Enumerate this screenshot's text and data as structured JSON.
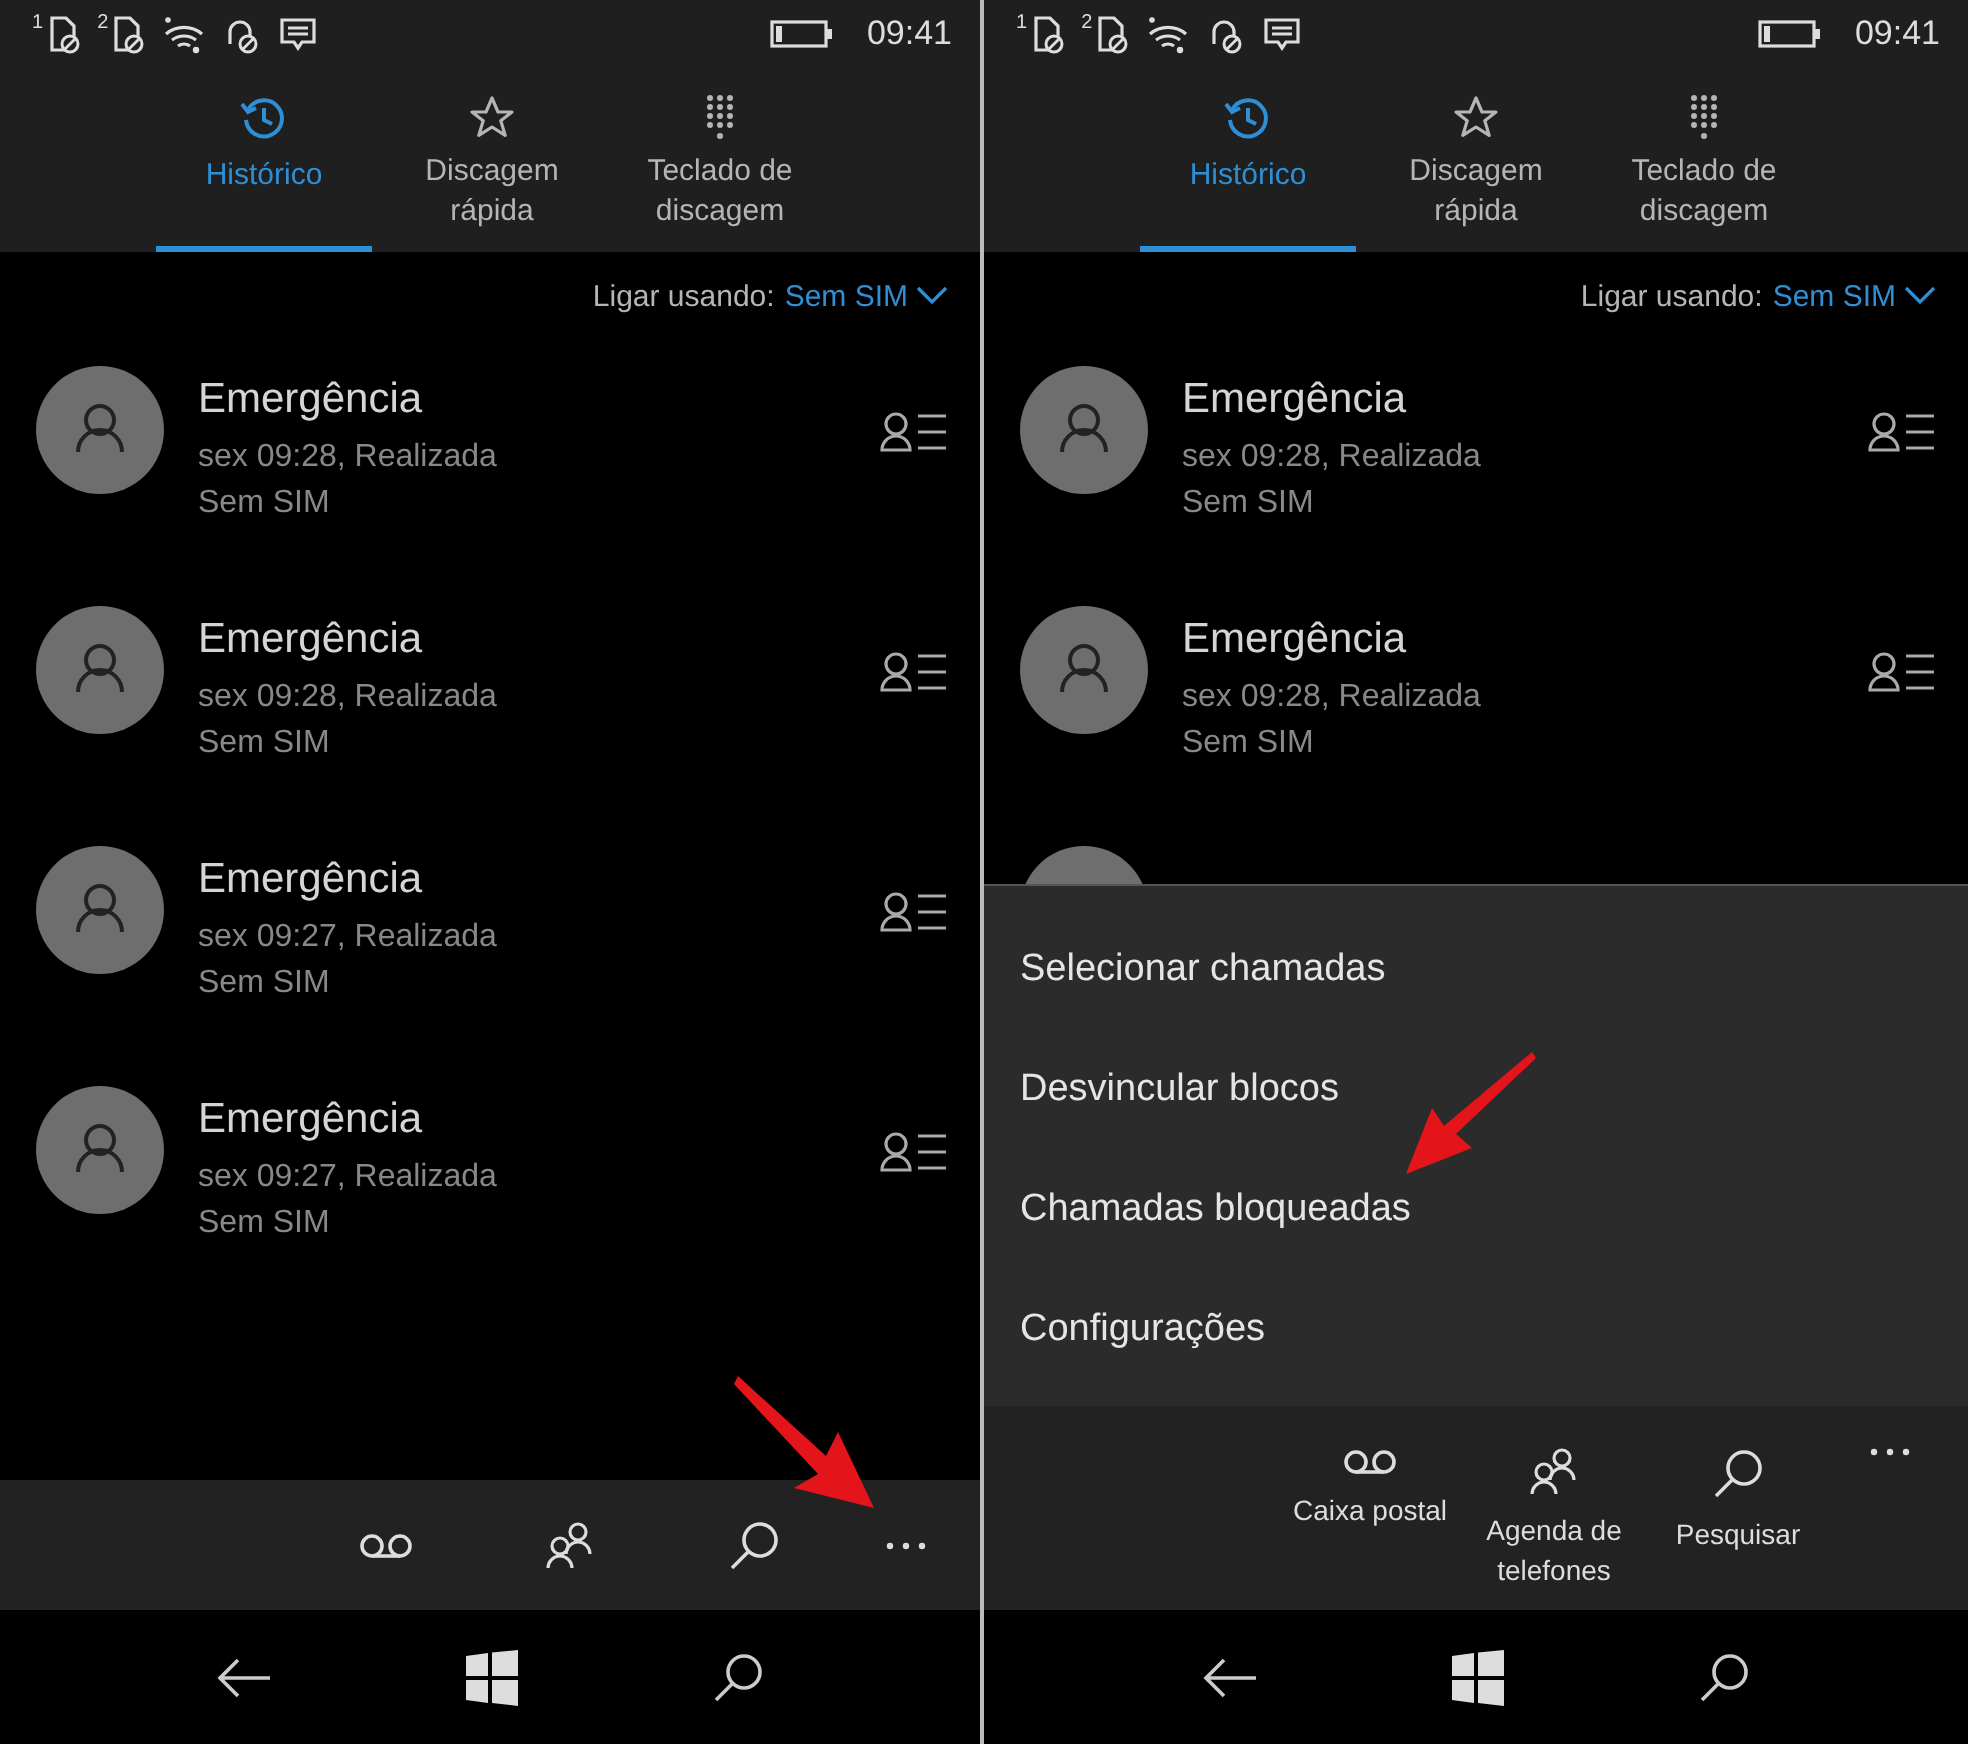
{
  "screens": [
    {
      "status_bar": {
        "icons": [
          {
            "kind": "sim",
            "label": "1"
          },
          {
            "kind": "sim",
            "label": "2"
          },
          {
            "kind": "wifi"
          },
          {
            "kind": "alarm"
          },
          {
            "kind": "message"
          }
        ],
        "time": "09:41"
      },
      "tabs": [
        {
          "label": "Histórico",
          "selected": true
        },
        {
          "label": "Discagem rápida",
          "selected": false
        },
        {
          "label": "Teclado de discagem",
          "selected": false
        }
      ],
      "call_using": {
        "label": "Ligar usando:",
        "value": "Sem SIM"
      },
      "calls": [
        {
          "name": "Emergência",
          "detail": "sex 09:28, Realizada",
          "sim": "Sem SIM"
        },
        {
          "name": "Emergência",
          "detail": "sex 09:28, Realizada",
          "sim": "Sem SIM"
        },
        {
          "name": "Emergência",
          "detail": "sex 09:27, Realizada",
          "sim": "Sem SIM"
        },
        {
          "name": "Emergência",
          "detail": "sex 09:27, Realizada",
          "sim": "Sem SIM"
        }
      ],
      "app_bar": {
        "expanded": false
      }
    },
    {
      "status_bar": {
        "icons": [
          {
            "kind": "sim",
            "label": "1"
          },
          {
            "kind": "sim",
            "label": "2"
          },
          {
            "kind": "wifi"
          },
          {
            "kind": "alarm"
          },
          {
            "kind": "message"
          }
        ],
        "time": "09:41"
      },
      "tabs": [
        {
          "label": "Histórico",
          "selected": true
        },
        {
          "label": "Discagem rápida",
          "selected": false
        },
        {
          "label": "Teclado de discagem",
          "selected": false
        }
      ],
      "call_using": {
        "label": "Ligar usando:",
        "value": "Sem SIM"
      },
      "calls": [
        {
          "name": "Emergência",
          "detail": "sex 09:28, Realizada",
          "sim": "Sem SIM"
        },
        {
          "name": "Emergência",
          "detail": "sex 09:28, Realizada",
          "sim": "Sem SIM"
        }
      ],
      "menu": {
        "items": [
          "Selecionar chamadas",
          "Desvincular blocos",
          "Chamadas bloqueadas",
          "Configurações"
        ]
      },
      "app_bar": {
        "expanded": true,
        "labels": [
          "Caixa postal",
          "Agenda de telefones",
          "Pesquisar"
        ]
      }
    }
  ]
}
